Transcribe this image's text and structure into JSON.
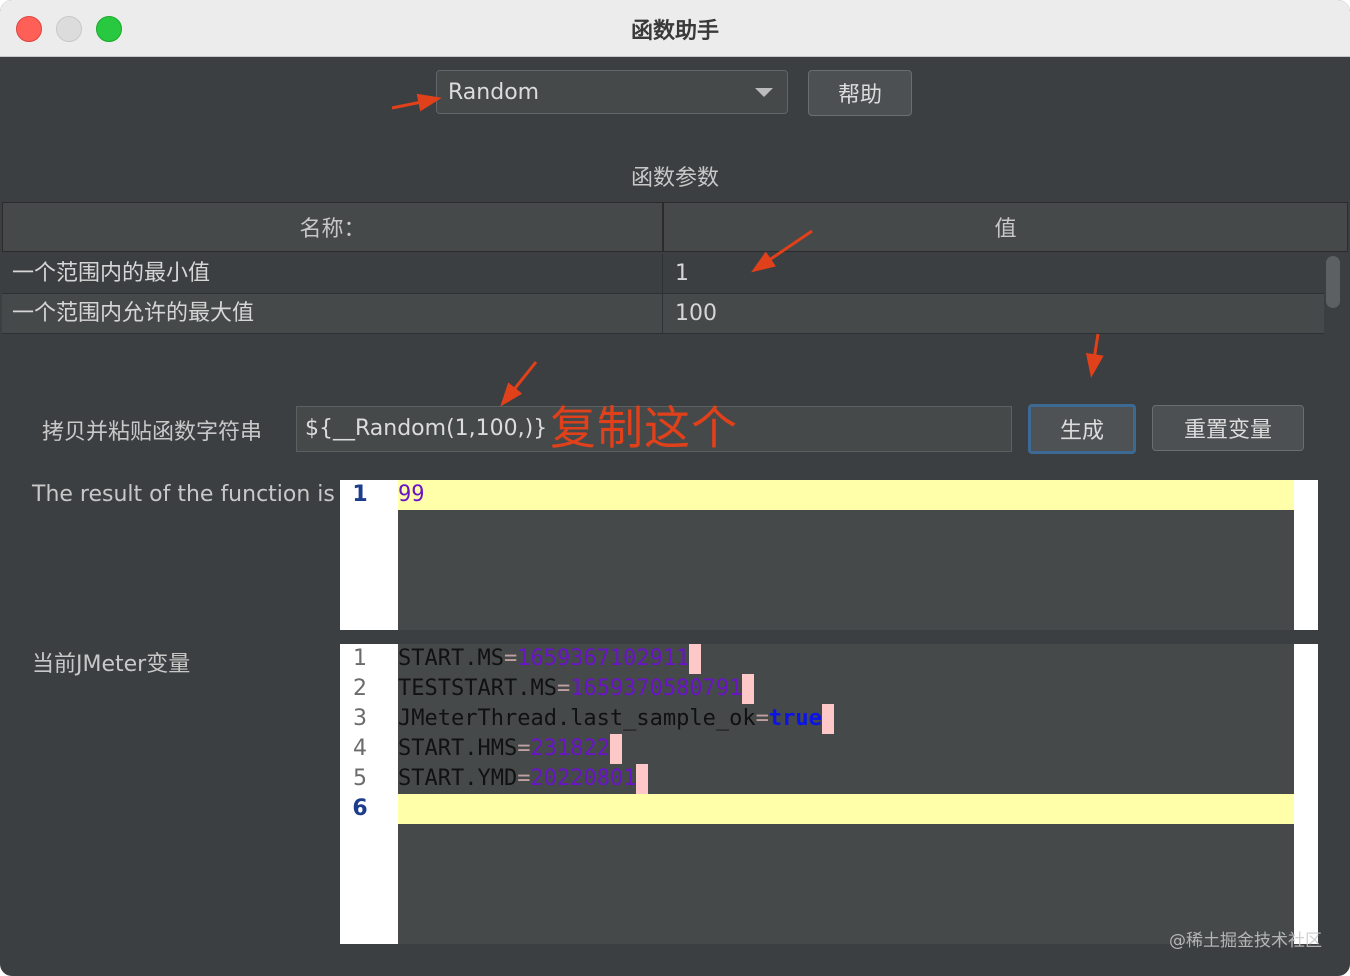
{
  "window": {
    "title": "函数助手"
  },
  "function_selector": {
    "selected": "Random",
    "help_button": "帮助"
  },
  "params": {
    "section_title": "函数参数",
    "columns": [
      "名称：",
      "值"
    ],
    "rows": [
      {
        "name": "一个范围内的最小值",
        "value": "1"
      },
      {
        "name": "一个范围内允许的最大值",
        "value": "100"
      }
    ]
  },
  "function_string": {
    "label": "拷贝并粘贴函数字符串",
    "value": "${__Random(1,100,)}",
    "generate_button": "生成",
    "reset_button": "重置变量"
  },
  "annotation": {
    "text": "复制这个"
  },
  "result": {
    "label": "The result of the function is",
    "lines": [
      {
        "num": "1",
        "text": "99"
      }
    ]
  },
  "variables": {
    "label": "当前JMeter变量",
    "lines": [
      {
        "num": "1",
        "key": "START.MS",
        "eq": "=",
        "value": "1659367102911"
      },
      {
        "num": "2",
        "key": "TESTSTART.MS",
        "eq": "=",
        "value": "1659370580791"
      },
      {
        "num": "3",
        "key": "JMeterThread.last_sample_ok",
        "eq": "=",
        "value": "true"
      },
      {
        "num": "4",
        "key": "START.HMS",
        "eq": "=",
        "value": "231822"
      },
      {
        "num": "5",
        "key": "START.YMD",
        "eq": "=",
        "value": "20220801"
      },
      {
        "num": "6",
        "key": "",
        "eq": "",
        "value": ""
      }
    ]
  },
  "watermark": "@稀土掘金技术社区",
  "colors": {
    "annotation": "#e0401a",
    "highlight_line": "#ffffa9",
    "value_purple": "#6a14c8",
    "keyword_blue": "#0a14e6"
  }
}
